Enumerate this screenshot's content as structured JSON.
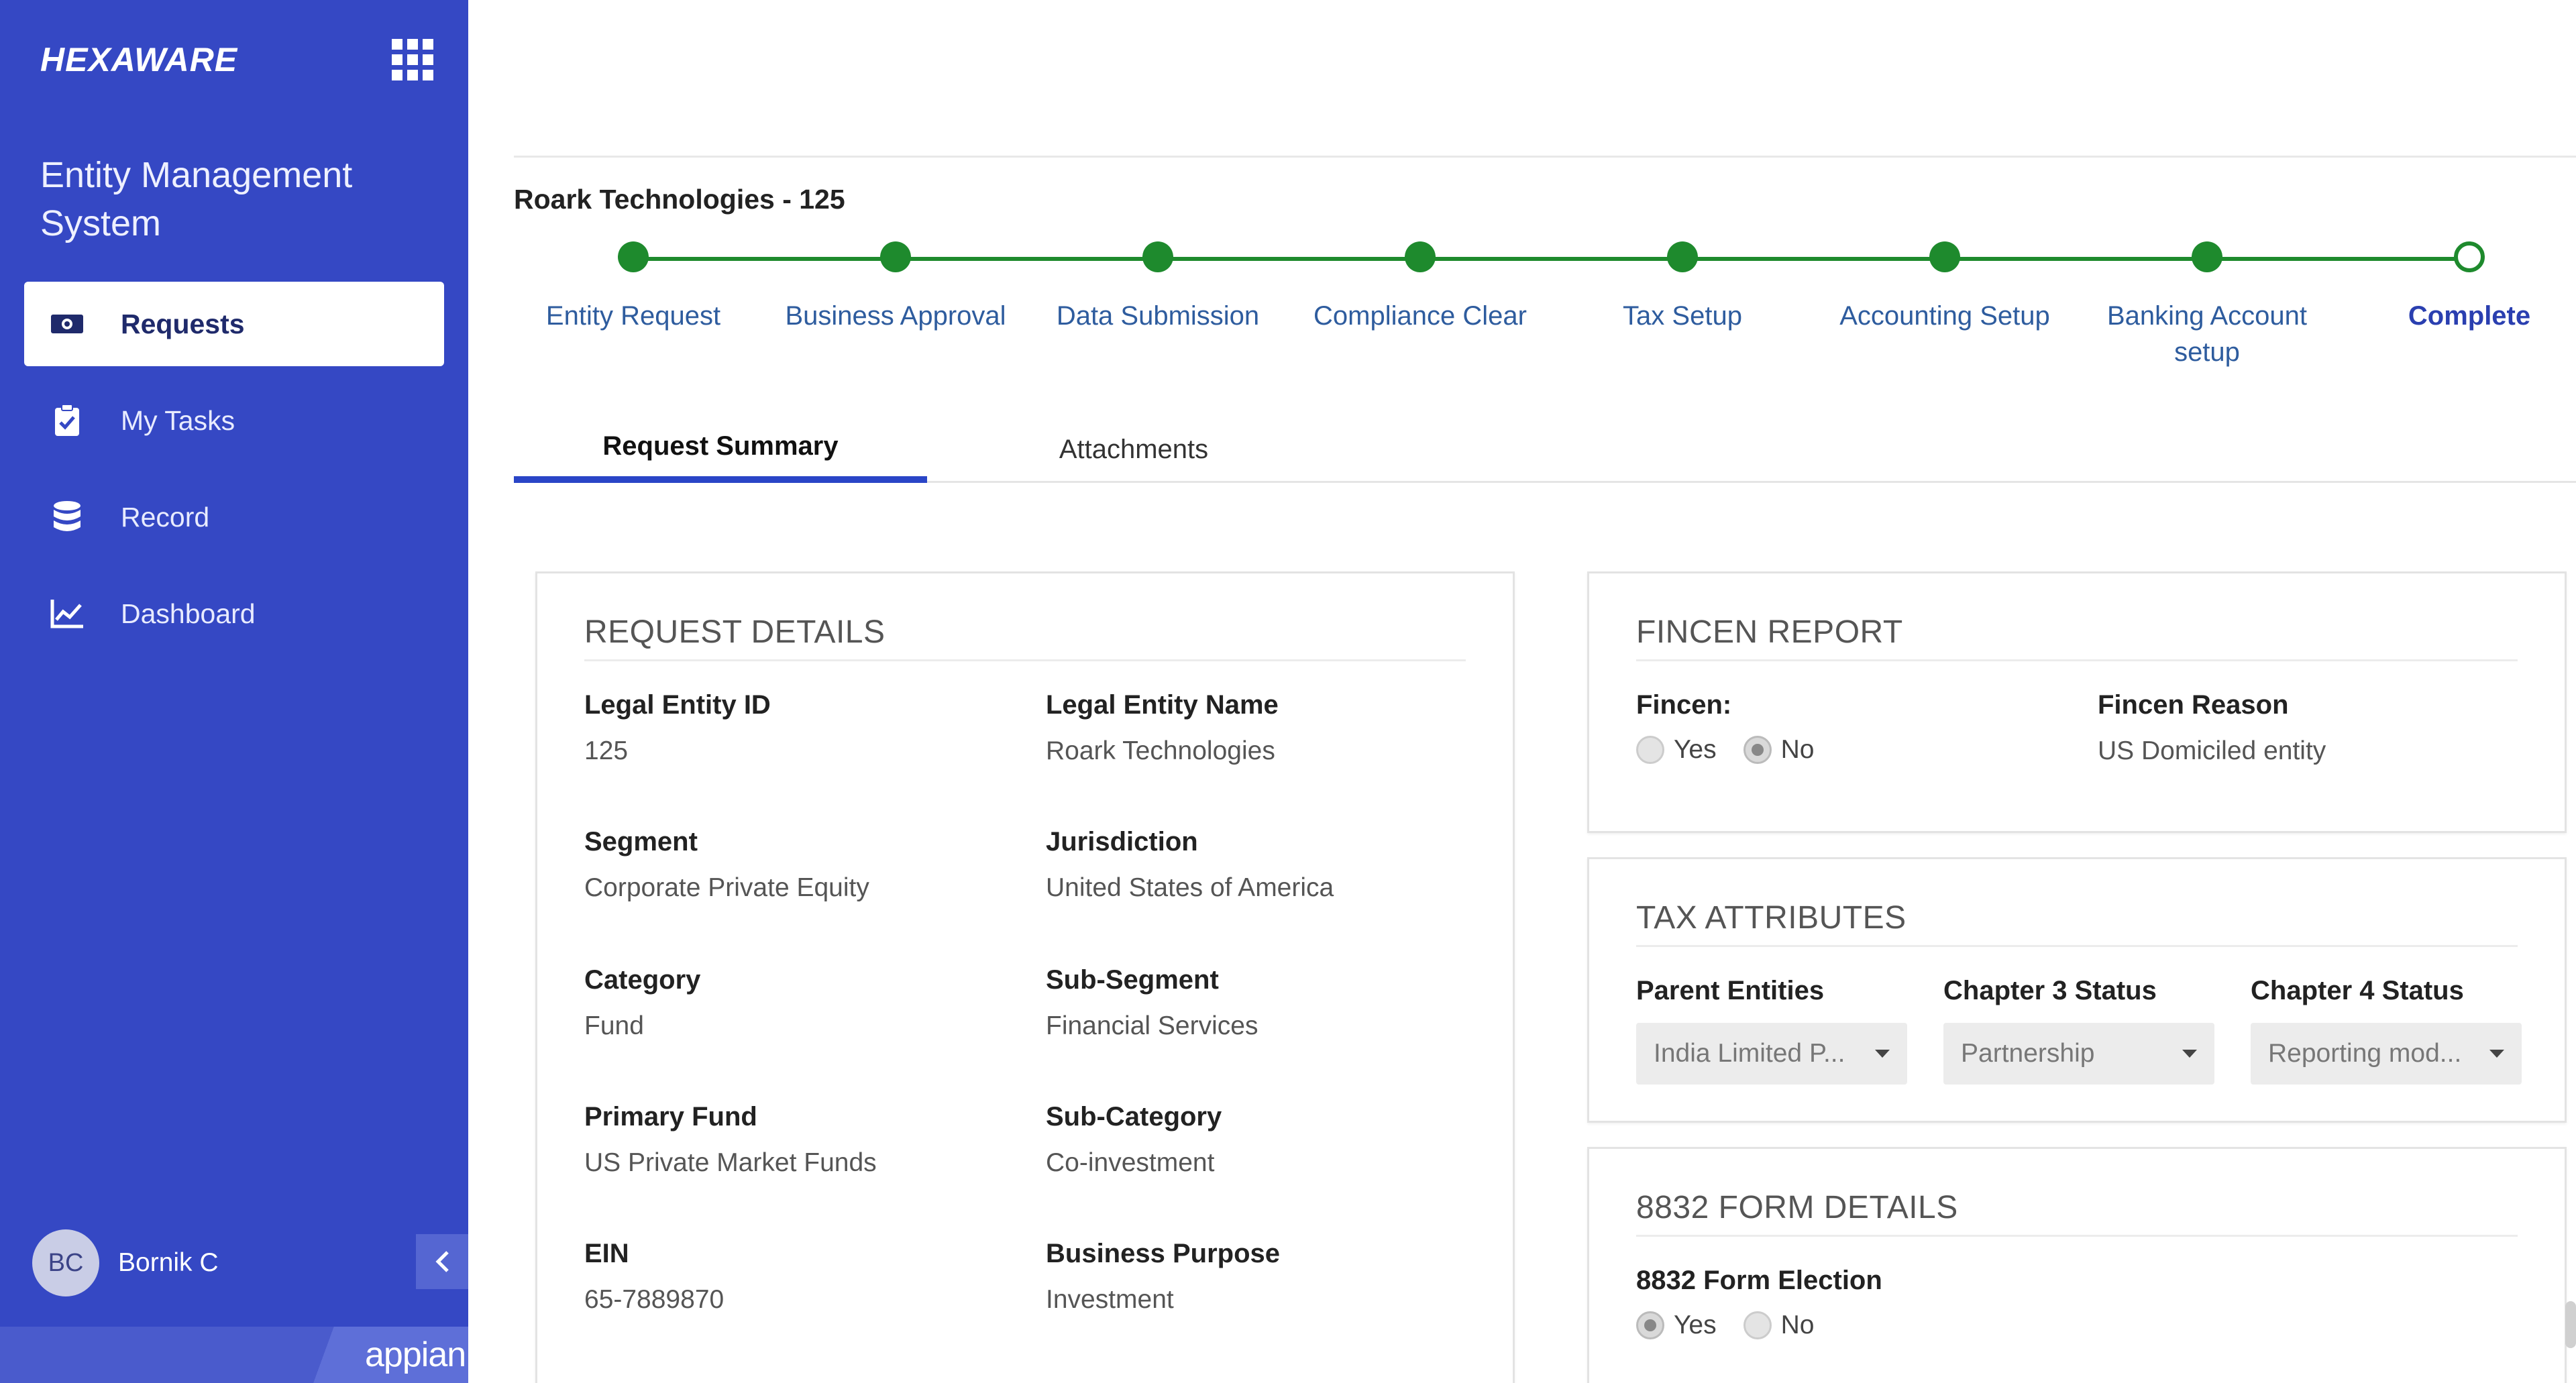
{
  "sidebar": {
    "logo": "HEXAWARE",
    "app_title": "Entity Management System",
    "items": [
      {
        "label": "Requests",
        "icon": "money-icon",
        "active": true
      },
      {
        "label": "My Tasks",
        "icon": "clipboard-check-icon",
        "active": false
      },
      {
        "label": "Record",
        "icon": "database-icon",
        "active": false
      },
      {
        "label": "Dashboard",
        "icon": "line-chart-icon",
        "active": false
      }
    ],
    "user": {
      "initials": "BC",
      "name": "Bornik C"
    },
    "footer_brand": "appian"
  },
  "entity_title": "Roark Technologies - 125",
  "progress": {
    "steps": [
      {
        "label": "Entity Request",
        "state": "done"
      },
      {
        "label": "Business Approval",
        "state": "done"
      },
      {
        "label": "Data Submission",
        "state": "done"
      },
      {
        "label": "Compliance Clear",
        "state": "done"
      },
      {
        "label": "Tax Setup",
        "state": "done"
      },
      {
        "label": "Accounting Setup",
        "state": "done"
      },
      {
        "label": "Banking Account setup",
        "state": "done"
      },
      {
        "label": "Complete",
        "state": "current"
      }
    ],
    "color": "#1e8a2d"
  },
  "tabs": [
    {
      "label": "Request Summary",
      "active": true
    },
    {
      "label": "Attachments",
      "active": false
    }
  ],
  "request_details": {
    "title": "REQUEST DETAILS",
    "fields": [
      {
        "label": "Legal Entity ID",
        "value": "125"
      },
      {
        "label": "Legal Entity Name",
        "value": "Roark Technologies"
      },
      {
        "label": "Segment",
        "value": "Corporate Private Equity"
      },
      {
        "label": "Jurisdiction",
        "value": "United States of America"
      },
      {
        "label": "Category",
        "value": "Fund"
      },
      {
        "label": "Sub-Segment",
        "value": "Financial Services"
      },
      {
        "label": "Primary Fund",
        "value": "US Private Market Funds"
      },
      {
        "label": "Sub-Category",
        "value": "Co-investment"
      },
      {
        "label": "EIN",
        "value": "65-7889870"
      },
      {
        "label": "Business Purpose",
        "value": "Investment"
      }
    ]
  },
  "fincen": {
    "title": "FINCEN REPORT",
    "fincen_label": "Fincen:",
    "options": [
      "Yes",
      "No"
    ],
    "selected": "No",
    "reason_label": "Fincen Reason",
    "reason_value": "US Domiciled entity"
  },
  "tax": {
    "title": "TAX ATTRIBUTES",
    "fields": [
      {
        "label": "Parent Entities",
        "value": "India Limited P..."
      },
      {
        "label": "Chapter 3 Status",
        "value": "Partnership"
      },
      {
        "label": "Chapter 4 Status",
        "value": "Reporting mod..."
      }
    ]
  },
  "form8832": {
    "title": "8832 FORM DETAILS",
    "election_label": "8832 Form Election",
    "options": [
      "Yes",
      "No"
    ],
    "selected": "Yes"
  },
  "colors": {
    "sidebar": "#3548c4",
    "accent": "#2a45c7",
    "progress": "#1e8a2d"
  }
}
